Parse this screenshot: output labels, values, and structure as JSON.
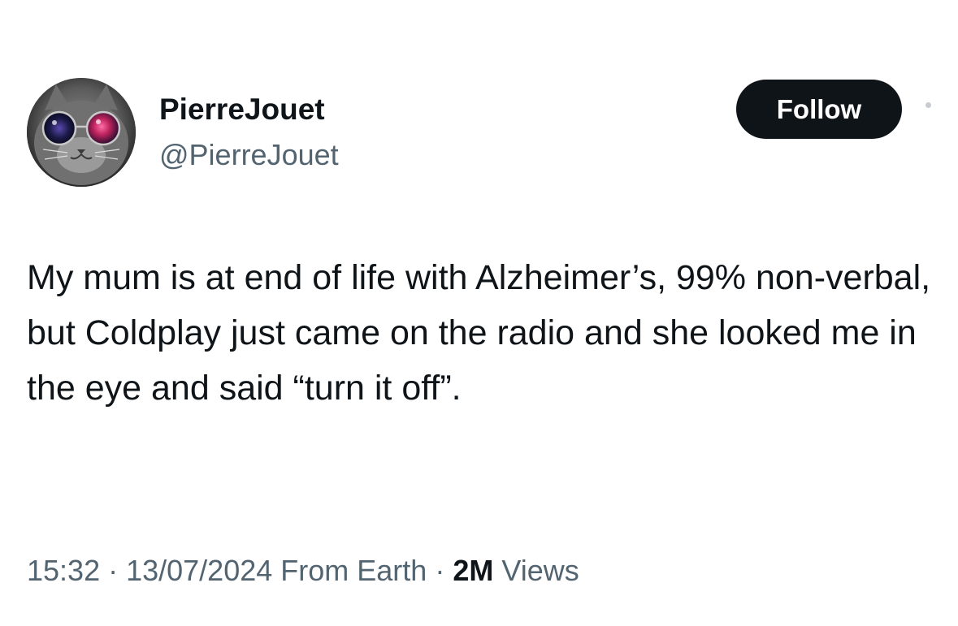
{
  "author": {
    "display_name": "PierreJouet",
    "handle": "@PierreJouet",
    "avatar_icon": "cat-with-glasses-avatar"
  },
  "follow_button": {
    "label": "Follow",
    "background": "#0f1419",
    "text_color": "#ffffff"
  },
  "tweet": {
    "text": "My mum is at end of life with Alzheimer’s, 99% non-verbal, but Coldplay just came on the radio and she looked me in the eye and said “turn it off”."
  },
  "meta": {
    "time": "15:32",
    "separator": " · ",
    "date": "13/07/2024",
    "source": " From Earth",
    "views_count": "2M",
    "views_label": " Views"
  },
  "colors": {
    "primary_text": "#0f1419",
    "secondary_text": "#536471",
    "background": "#ffffff"
  }
}
